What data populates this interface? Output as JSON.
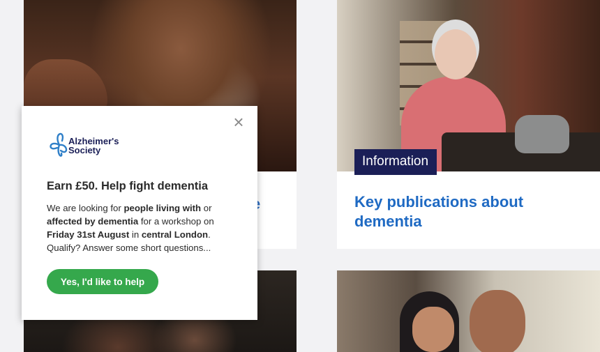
{
  "cards": {
    "top_left": {
      "title_fragment": "e"
    },
    "top_right": {
      "tag": "Information",
      "title": "Key publications about dementia"
    }
  },
  "popup": {
    "logo_text_line1": "Alzheimer's",
    "logo_text_line2": "Society",
    "heading": "Earn £50. Help fight dementia",
    "body": {
      "t1": "We are looking for ",
      "b1": "people living with",
      "t2": " or ",
      "b2": "affected by dementia",
      "t3": " for a workshop on ",
      "b3": "Friday 31st August",
      "t4": " in ",
      "b4": "central London",
      "t5": ". Qualify? Answer some short questions..."
    },
    "cta_label": "Yes, I'd like to help",
    "close_label": "×"
  },
  "colors": {
    "accent_blue": "#1f6ac3",
    "tag_navy": "#1b1f57",
    "cta_green": "#35a84c"
  },
  "icons": [
    "close-icon",
    "alzheimers-society-logo-icon"
  ]
}
